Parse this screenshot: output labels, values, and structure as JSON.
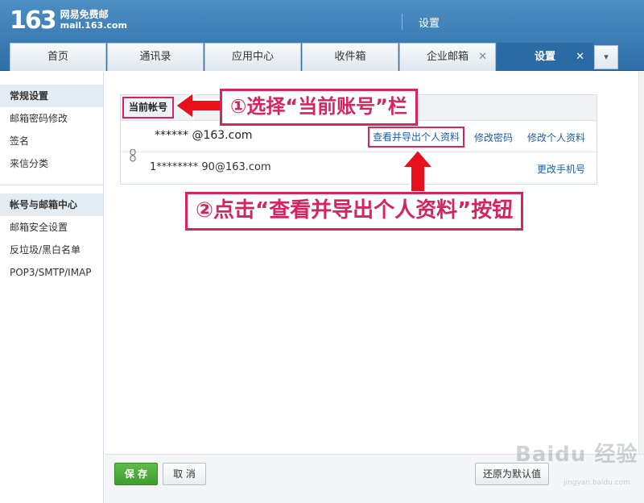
{
  "header": {
    "logo_number": "163",
    "logo_cn": "网易免费邮",
    "logo_url": "mail.163.com",
    "title": "设置"
  },
  "tabs": [
    {
      "label": "首页"
    },
    {
      "label": "通讯录"
    },
    {
      "label": "应用中心"
    },
    {
      "label": "收件箱"
    },
    {
      "label": "企业邮箱"
    },
    {
      "label": "设置"
    }
  ],
  "sidebar": {
    "section1": {
      "heading": "常规设置",
      "items": [
        "邮箱密码修改",
        "签名",
        "来信分类"
      ]
    },
    "section2": {
      "heading": "帐号与邮箱中心",
      "items": [
        "邮箱安全设置",
        "反垃圾/黑白名单",
        "POP3/SMTP/IMAP"
      ]
    }
  },
  "card": {
    "header_label": "当前帐号",
    "primary_account": "****** @163.com",
    "secondary_account": "1******** 90@163.com",
    "links": {
      "export_profile": "查看并导出个人资料",
      "change_password": "修改密码",
      "edit_profile": "修改个人资料",
      "change_phone": "更改手机号"
    }
  },
  "annotations": {
    "step1": "①选择“当前账号”栏",
    "step2": "②点击“查看并导出个人资料”按钮"
  },
  "footer": {
    "save": "保 存",
    "cancel": "取 消",
    "reset": "还原为默认值"
  },
  "watermark": {
    "text": "Baidu 经验",
    "sub": "jingyan.baidu.com"
  },
  "colors": {
    "header_blue": "#2f6ea8",
    "annotation_red": "#d6245f",
    "link_blue": "#1f5fa6",
    "save_green": "#3e9d2e"
  }
}
